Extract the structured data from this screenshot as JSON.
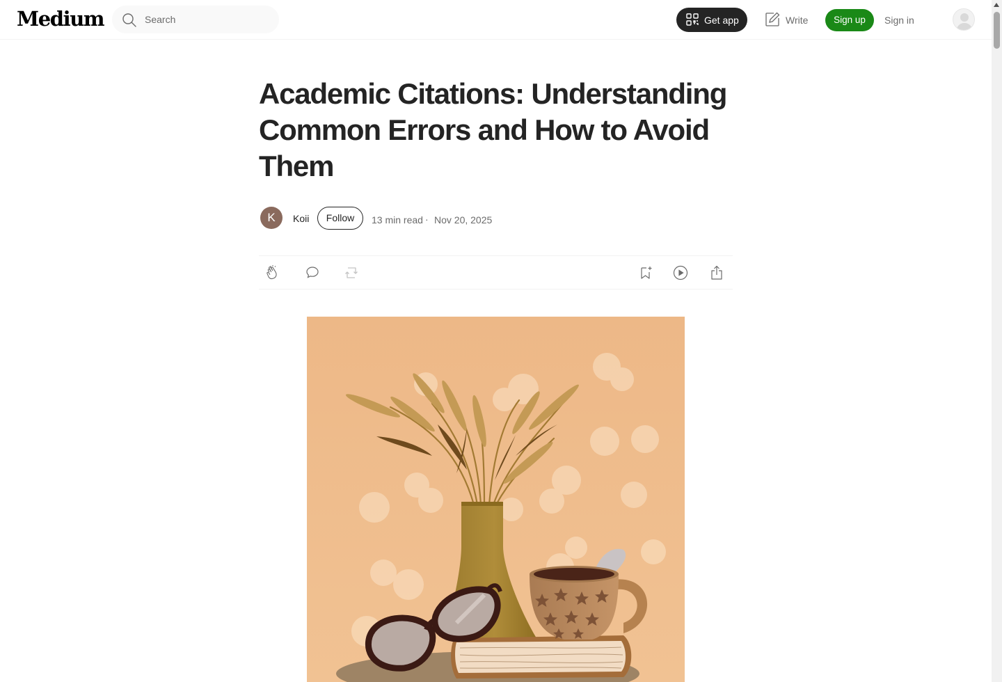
{
  "header": {
    "logo": "Medium",
    "search": {
      "placeholder": "Search"
    },
    "get_app_label": "Get app",
    "write_label": "Write",
    "sign_up_label": "Sign up",
    "sign_in_label": "Sign in"
  },
  "article": {
    "title": "Academic Citations: Understanding Common Errors and How to Avoid Them",
    "author": {
      "initial": "K",
      "name": "Koii"
    },
    "follow_label": "Follow",
    "read_time": "13 min read",
    "separator": "·",
    "date": "Nov 20, 2025"
  },
  "actions": {
    "left": [
      "clap-icon",
      "comment-icon",
      "repost-icon"
    ],
    "right": [
      "bookmark-add-icon",
      "listen-icon",
      "share-icon"
    ]
  },
  "theme": {
    "accent_green": "#1a8917",
    "text_primary": "#242424",
    "text_secondary": "#6b6b6b",
    "dark_button": "#242424",
    "author_avatar": "#8a6a5d",
    "hero_background": "#efb985"
  }
}
